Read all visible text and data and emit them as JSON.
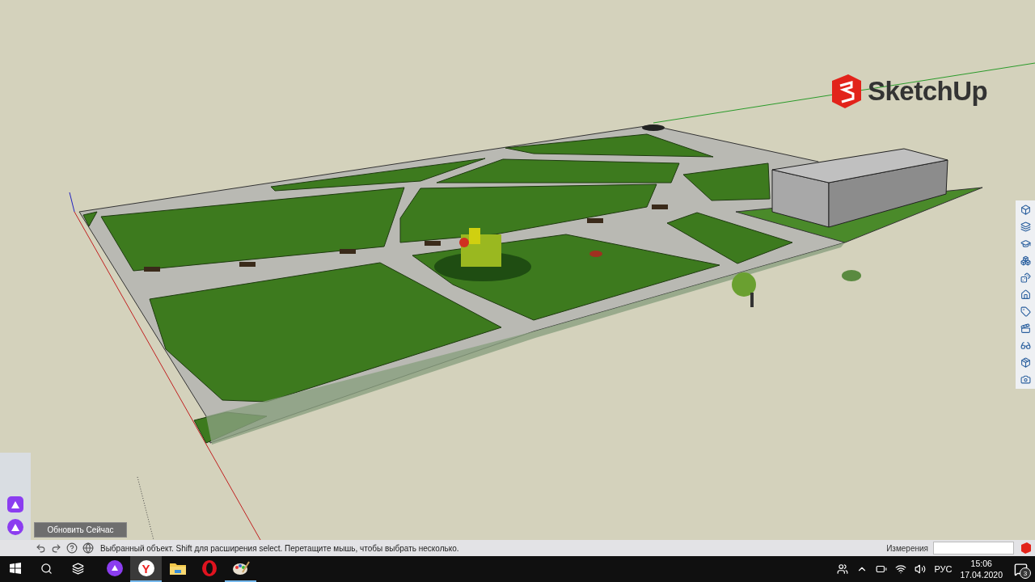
{
  "logo": {
    "text": "SketchUp"
  },
  "update_button": {
    "label": "Обновить Сейчас"
  },
  "status_bar": {
    "message": "Выбранный объект. Shift для расширения select. Перетащите мышь, чтобы выбрать несколько.",
    "measurements_label": "Измерения"
  },
  "taskbar": {
    "apps": [
      {
        "kind": "alice",
        "selected": false,
        "running": false
      },
      {
        "kind": "yandex",
        "glyph": "Y",
        "selected": true,
        "running": true
      },
      {
        "kind": "explorer",
        "selected": false,
        "running": false
      },
      {
        "kind": "opera",
        "selected": false,
        "running": false
      },
      {
        "kind": "paint",
        "selected": false,
        "running": true
      }
    ],
    "language": "РУС",
    "time": "15:06",
    "date": "17.04.2020",
    "notifications": "3"
  }
}
